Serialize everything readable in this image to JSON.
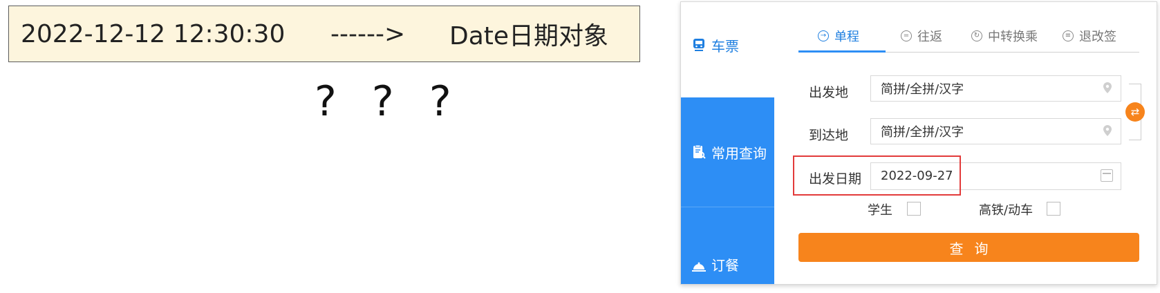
{
  "slide": {
    "from_text": "2022-12-12 12:30:30",
    "arrow_text": "------>",
    "to_text": "Date日期对象",
    "question_text": "? ? ?"
  },
  "sidebar": {
    "items": [
      {
        "label": "车票",
        "icon": "train-icon"
      },
      {
        "label": "常用查询",
        "icon": "clipboard-search-icon"
      },
      {
        "label": "订餐",
        "icon": "food-cloche-icon"
      }
    ]
  },
  "tabs": [
    {
      "label": "单程",
      "icon": "arrow-right-circle-icon",
      "active": true
    },
    {
      "label": "往返",
      "icon": "equals-circle-icon",
      "active": false
    },
    {
      "label": "中转换乘",
      "icon": "transfer-circle-icon",
      "active": false
    },
    {
      "label": "退改签",
      "icon": "refund-circle-icon",
      "active": false
    }
  ],
  "form": {
    "from_label": "出发地",
    "from_value": "简拼/全拼/汉字",
    "to_label": "到达地",
    "to_value": "简拼/全拼/汉字",
    "date_label": "出发日期",
    "date_value": "2022-09-27",
    "student_label": "学生",
    "highspeed_label": "高铁/动车",
    "search_label": "查询"
  },
  "colors": {
    "accent_blue": "#2d8ef5",
    "accent_orange": "#f7841c",
    "highlight_red": "#e23a3a",
    "slide_box_bg": "#fdf5dd"
  }
}
